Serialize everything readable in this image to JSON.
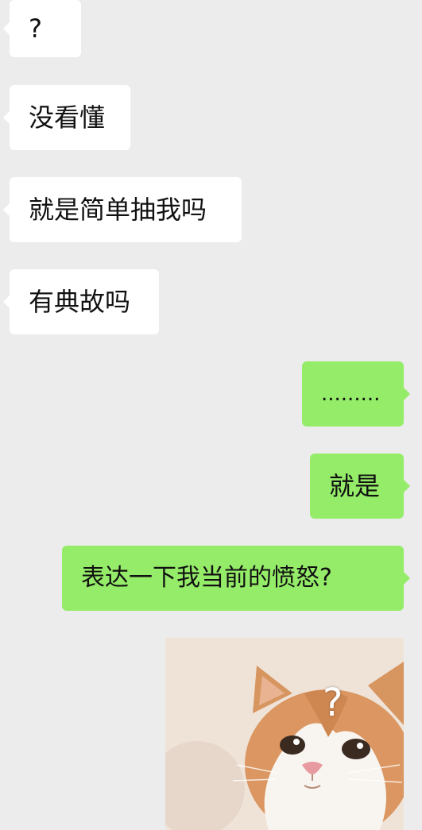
{
  "messages": {
    "m1": "?",
    "m2": "没看懂",
    "m3": "就是简单抽我吗",
    "m4": "有典故吗",
    "m5": ".........",
    "m6": "就是",
    "m7": "表达一下我当前的愤怒?"
  },
  "sticker": {
    "icon": "confused-cat-sticker-icon",
    "mark": "?",
    "colors": {
      "background": "#efe3d8",
      "fur_orange": "#d9915a",
      "fur_white": "#f8f4ef"
    }
  },
  "colors": {
    "incoming_bubble": "#ffffff",
    "outgoing_bubble": "#95ec69",
    "chat_background": "#ececec"
  }
}
